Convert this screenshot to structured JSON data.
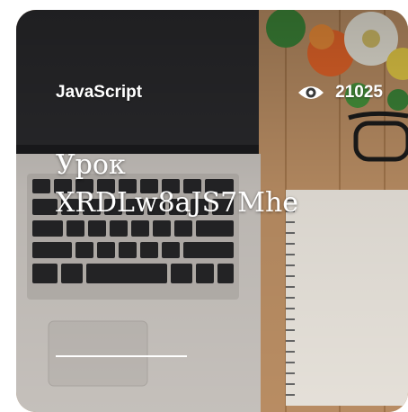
{
  "card": {
    "category": "JavaScript",
    "views": "21025",
    "title_line1": "Урок",
    "title_line2": "XRDLw8aJS7Mhe",
    "view_icon": "eye-icon",
    "background_image": "laptop-desk-photo"
  },
  "colors": {
    "text": "#ffffff",
    "desk": "#b88a5c",
    "laptop": "#c9c4bf",
    "keys": "#2a2a2c"
  }
}
